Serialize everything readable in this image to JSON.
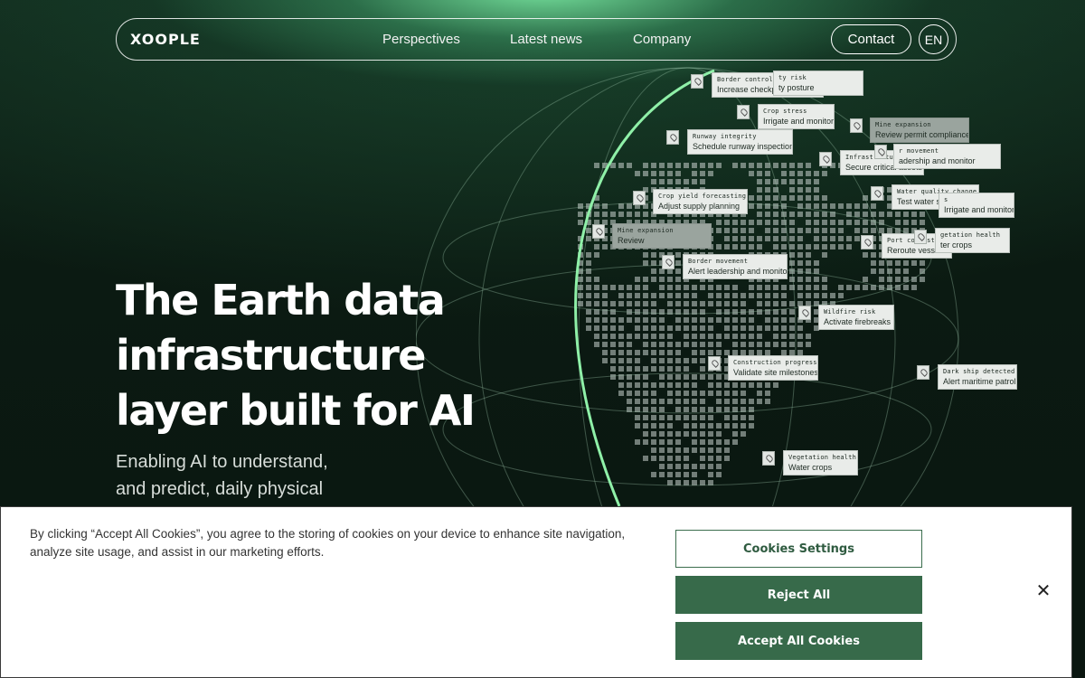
{
  "nav": {
    "logo": "XOOPLE",
    "links": [
      "Perspectives",
      "Latest news",
      "Company"
    ],
    "contact": "Contact",
    "language": "EN"
  },
  "hero": {
    "title": "The Earth data infrastructure layer built for AI",
    "subtitle": "Enabling AI to understand, and predict, daily physical"
  },
  "globe_tags": [
    {
      "title": "Border control risk",
      "action": "Increase checkpoint screening"
    },
    {
      "title": "ty risk",
      "action": "ty posture"
    },
    {
      "title": "Crop stress",
      "action": "Irrigate and monitor"
    },
    {
      "title": "Mine expansion",
      "action": "Review permit compliance"
    },
    {
      "title": "Runway integrity",
      "action": "Schedule runway inspection"
    },
    {
      "title": "Infrastructure risk",
      "action": "Secure critical assets"
    },
    {
      "title": "r movement",
      "action": "adership and monitor"
    },
    {
      "title": "Water quality change",
      "action": "Test water samples"
    },
    {
      "title": "s",
      "action": "Irrigate and monitor"
    },
    {
      "title": "Crop yield forecasting",
      "action": "Adjust supply planning"
    },
    {
      "title": "Mine expansion",
      "action": "Review"
    },
    {
      "title": "Port congestion",
      "action": "Reroute vessels"
    },
    {
      "title": "getation health",
      "action": "ter crops"
    },
    {
      "title": "Border movement",
      "action": "Alert leadership and monitor"
    },
    {
      "title": "Wildfire risk",
      "action": "Activate firebreaks"
    },
    {
      "title": "Construction progress",
      "action": "Validate site milestones"
    },
    {
      "title": "Dark ship detected",
      "action": "Alert maritime patrol"
    },
    {
      "title": "Vegetation health",
      "action": "Water crops"
    }
  ],
  "cookie": {
    "text": "By clicking “Accept All Cookies”, you agree to the storing of cookies on your device to enhance site navigation, analyze site usage, and assist in our marketing efforts.",
    "settings": "Cookies Settings",
    "reject": "Reject All",
    "accept": "Accept All Cookies",
    "close": "✕"
  },
  "colors": {
    "background": "#0c1a13",
    "glow": "#7ee6a0",
    "accent_line": "#8ff0a8",
    "button_green": "#376a4a"
  }
}
